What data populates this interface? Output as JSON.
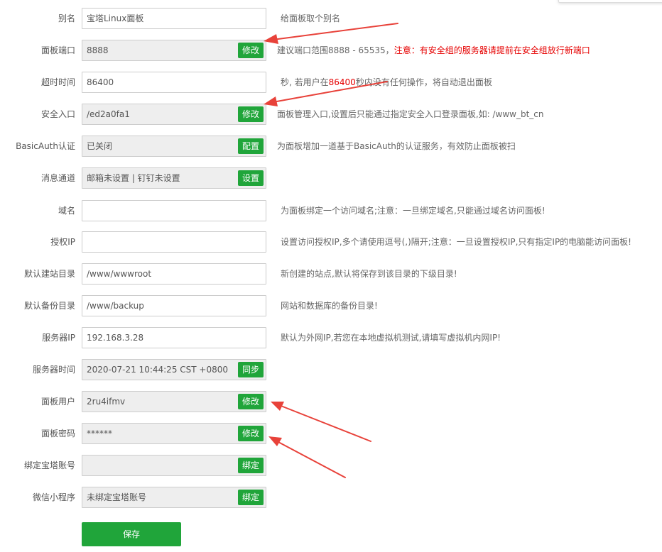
{
  "colors": {
    "accent": "#20a53a",
    "warning": "#e60000",
    "arrow": "#e8423a"
  },
  "fields": [
    {
      "label": "别名",
      "value": "宝塔Linux面板",
      "readonly": false,
      "hint": "给面板取个别名"
    },
    {
      "label": "面板端口",
      "value": "8888",
      "readonly": true,
      "button": "修改",
      "hint": "建议端口范围8888 - 65535，",
      "hint_warning": "注意：有安全组的服务器请提前在安全组放行新端口"
    },
    {
      "label": "超时时间",
      "value": "86400",
      "readonly": false,
      "hint_pre": "秒, 若用户在",
      "hint_num": "86400",
      "hint_post": "秒内没有任何操作，将自动退出面板"
    },
    {
      "label": "安全入口",
      "value": "/ed2a0fa1",
      "readonly": true,
      "button": "修改",
      "hint": "面板管理入口,设置后只能通过指定安全入口登录面板,如: /www_bt_cn"
    },
    {
      "label": "BasicAuth认证",
      "value": "已关闭",
      "readonly": true,
      "button": "配置",
      "hint": "为面板增加一道基于BasicAuth的认证服务，有效防止面板被扫"
    },
    {
      "label": "消息通道",
      "value": "邮箱未设置 | 钉钉未设置",
      "readonly": true,
      "button": "设置",
      "hint": ""
    },
    {
      "label": "域名",
      "value": "",
      "readonly": false,
      "hint": "为面板绑定一个访问域名;注意：一旦绑定域名,只能通过域名访问面板!"
    },
    {
      "label": "授权IP",
      "value": "",
      "readonly": false,
      "hint": "设置访问授权IP,多个请使用逗号(,)隔开;注意：一旦设置授权IP,只有指定IP的电脑能访问面板!"
    },
    {
      "label": "默认建站目录",
      "value": "/www/wwwroot",
      "readonly": false,
      "hint": "新创建的站点,默认将保存到该目录的下级目录!"
    },
    {
      "label": "默认备份目录",
      "value": "/www/backup",
      "readonly": false,
      "hint": "网站和数据库的备份目录!"
    },
    {
      "label": "服务器IP",
      "value": "192.168.3.28",
      "readonly": false,
      "hint": "默认为外网IP,若您在本地虚拟机测试,请填写虚拟机内网IP!"
    },
    {
      "label": "服务器时间",
      "value": "2020-07-21 10:44:25 CST +0800",
      "readonly": true,
      "button": "同步",
      "hint": ""
    },
    {
      "label": "面板用户",
      "value": "2ru4ifmv",
      "readonly": true,
      "button": "修改",
      "hint": ""
    },
    {
      "label": "面板密码",
      "value": "******",
      "readonly": true,
      "button": "修改",
      "hint": ""
    },
    {
      "label": "绑定宝塔账号",
      "value": "",
      "readonly": true,
      "button": "绑定",
      "hint": ""
    },
    {
      "label": "微信小程序",
      "value": "未绑定宝塔账号",
      "readonly": true,
      "button": "绑定",
      "hint": ""
    }
  ],
  "save_label": "保存"
}
